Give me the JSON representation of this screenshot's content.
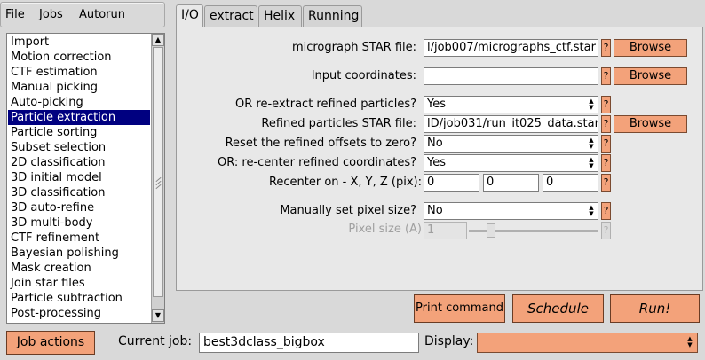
{
  "menu": [
    "File",
    "Jobs",
    "Autorun"
  ],
  "jobs": [
    "Import",
    "Motion correction",
    "CTF estimation",
    "Manual picking",
    "Auto-picking",
    "Particle extraction",
    "Particle sorting",
    "Subset selection",
    "2D classification",
    "3D initial model",
    "3D classification",
    "3D auto-refine",
    "3D multi-body",
    "CTF refinement",
    "Bayesian polishing",
    "Mask creation",
    "Join star files",
    "Particle subtraction",
    "Post-processing"
  ],
  "selected_job": "Particle extraction",
  "tabs": [
    "I/O",
    "extract",
    "Helix",
    "Running"
  ],
  "form": {
    "micrograph_label": "micrograph STAR file:",
    "micrograph_value": "l/job007/micrographs_ctf.star",
    "coords_label": "Input coordinates:",
    "coords_value": "",
    "reextract_label": "OR re-extract refined particles?",
    "reextract_value": "Yes",
    "refined_label": "Refined particles STAR file:",
    "refined_value": "lD/job031/run_it025_data.star",
    "reset_label": "Reset the refined offsets to zero?",
    "reset_value": "No",
    "recenter_label": "OR: re-center refined coordinates?",
    "recenter_value": "Yes",
    "xyz_label": "Recenter on - X, Y, Z (pix):",
    "x": "0",
    "y": "0",
    "z": "0",
    "manual_label": "Manually set pixel size?",
    "manual_value": "No",
    "pixel_label": "Pixel size (A)",
    "pixel_value": "1",
    "help": "?",
    "browse": "Browse"
  },
  "buttons": {
    "print": "Print command",
    "schedule": "Schedule",
    "run": "Run!"
  },
  "bottom": {
    "job_actions": "Job actions",
    "current_label": "Current job:",
    "current_value": "best3dclass_bigbox",
    "display_label": "Display:"
  },
  "colors": {
    "accent": "#f3a27a",
    "selection": "#000080",
    "panel": "#e8e8e8"
  }
}
